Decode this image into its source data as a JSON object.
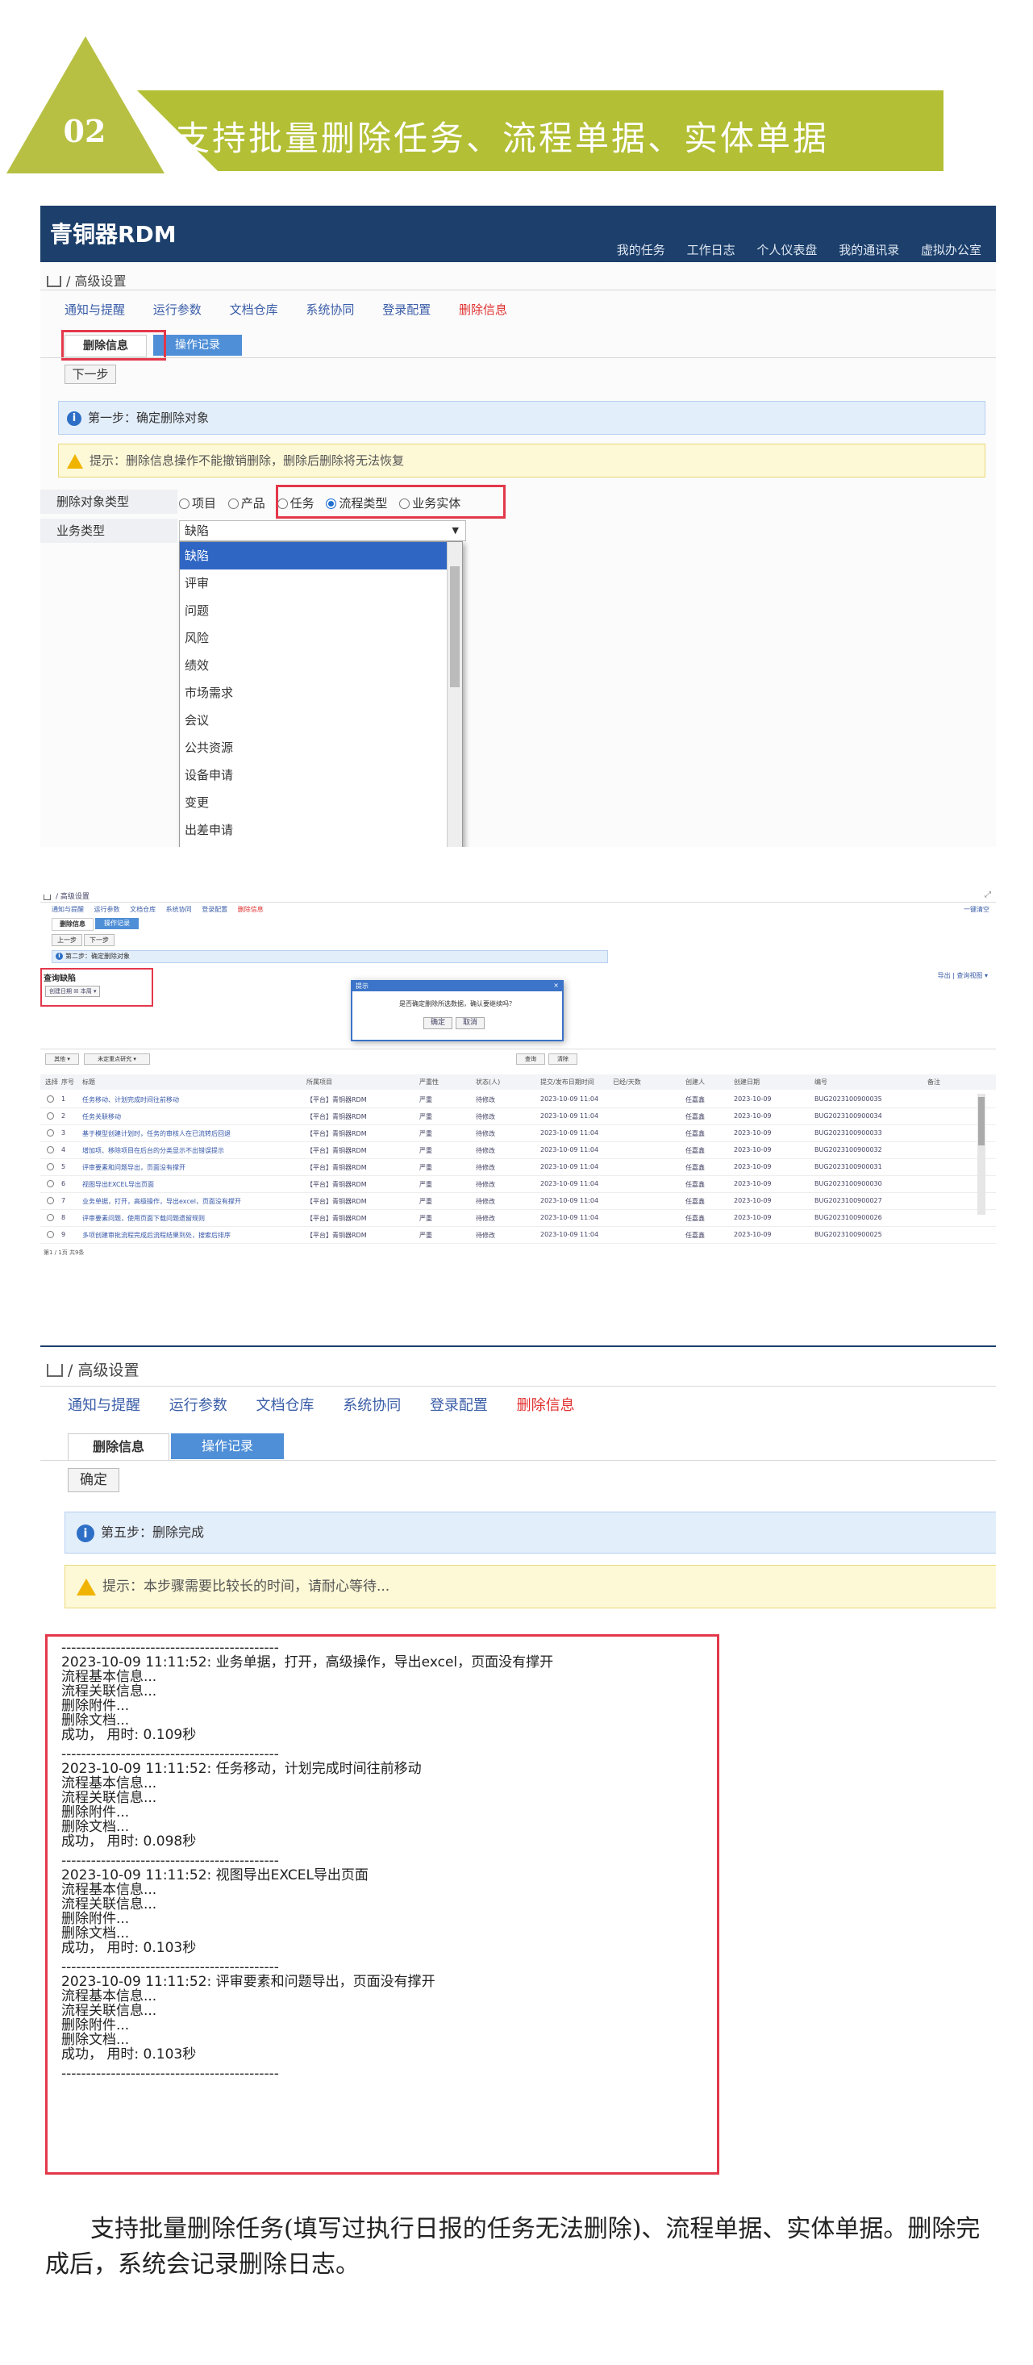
{
  "section": {
    "number": "02",
    "title": "支持批量删除任务、流程单据、实体单据"
  },
  "shot1": {
    "app_name": "青铜器RDM",
    "top_nav": [
      "我的任务",
      "工作日志",
      "个人仪表盘",
      "我的通讯录",
      "虚拟办公室"
    ],
    "breadcrumb": "高级设置",
    "tabs": [
      "通知与提醒",
      "运行参数",
      "文档仓库",
      "系统协同",
      "登录配置",
      "删除信息"
    ],
    "subtabs": [
      "删除信息",
      "操作记录"
    ],
    "next_button": "下一步",
    "step_info": "第一步：确定删除对象",
    "warning": "提示：删除信息操作不能撤销删除，删除后删除将无法恢复",
    "form": {
      "type_label": "删除对象类型",
      "type_options": [
        "项目",
        "产品",
        "任务",
        "流程类型",
        "业务实体"
      ],
      "type_selected": "流程类型",
      "biz_label": "业务类型",
      "biz_value": "缺陷"
    },
    "dropdown_items": [
      "缺陷",
      "评审",
      "问题",
      "风险",
      "绩效",
      "市场需求",
      "会议",
      "公共资源",
      "设备申请",
      "变更",
      "出差申请"
    ]
  },
  "shot2": {
    "breadcrumb": "高级设置",
    "tabs": [
      "通知与提醒",
      "运行参数",
      "文档仓库",
      "系统协同",
      "登录配置",
      "删除信息"
    ],
    "right_link": "一键清空",
    "subtabs": [
      "删除信息",
      "操作记录"
    ],
    "buttons": [
      "上一步",
      "下一步"
    ],
    "step_info": "第二步：确定删除对象",
    "query_title": "查询缺陷",
    "filter_chip": "创建日期 ☒ 本周 ▾",
    "right_tools": "导出 | 查询视图 ▾",
    "batch_label": "其他 ▾",
    "view_label": "未定重点研究 ▾",
    "search_buttons": [
      "查询",
      "清除"
    ],
    "modal": {
      "title": "提示",
      "message": "是否确定删除所选数据，确认要继续吗？",
      "ok": "确定",
      "cancel": "取消"
    },
    "columns": [
      "选择",
      "序号",
      "标题",
      "所属项目",
      "严重性",
      "状态(人)",
      "提交/发布日期时间",
      "已经/天数",
      "创建人",
      "创建日期",
      "编号",
      "备注"
    ],
    "rows": [
      [
        "1",
        "任务移动、计划完成时间往前移动",
        "【平台】青铜器RDM",
        "严重",
        "待修改",
        "2023-10-09 11:04",
        "任嘉鑫",
        "2023-10-09",
        "BUG2023100900035"
      ],
      [
        "2",
        "任务关联移动",
        "【平台】青铜器RDM",
        "严重",
        "待修改",
        "2023-10-09 11:04",
        "任嘉鑫",
        "2023-10-09",
        "BUG2023100900034"
      ],
      [
        "3",
        "基于模型创建计划时，任务的审核人在已流转后回退",
        "【平台】青铜器RDM",
        "严重",
        "待修改",
        "2023-10-09 11:04",
        "任嘉鑫",
        "2023-10-09",
        "BUG2023100900033"
      ],
      [
        "4",
        "增加项、移除项目在后台的分类显示不出错误提示",
        "【平台】青铜器RDM",
        "严重",
        "待修改",
        "2023-10-09 11:04",
        "任嘉鑫",
        "2023-10-09",
        "BUG2023100900032"
      ],
      [
        "5",
        "评审要素和问题导出，页面没有撑开",
        "【平台】青铜器RDM",
        "严重",
        "待修改",
        "2023-10-09 11:04",
        "任嘉鑫",
        "2023-10-09",
        "BUG2023100900031"
      ],
      [
        "6",
        "视图导出EXCEL导出页面",
        "【平台】青铜器RDM",
        "严重",
        "待修改",
        "2023-10-09 11:04",
        "任嘉鑫",
        "2023-10-09",
        "BUG2023100900030"
      ],
      [
        "7",
        "业务单据，打开，高级操作，导出excel，页面没有撑开",
        "【平台】青铜器RDM",
        "严重",
        "待修改",
        "2023-10-09 11:04",
        "任嘉鑫",
        "2023-10-09",
        "BUG2023100900027"
      ],
      [
        "8",
        "评审要素问题，使用页面下载问题遗留规则",
        "【平台】青铜器RDM",
        "严重",
        "待修改",
        "2023-10-09 11:04",
        "任嘉鑫",
        "2023-10-09",
        "BUG2023100900026"
      ],
      [
        "9",
        "多项创建审批流程完成后流程结果到处，搜索后排序",
        "【平台】青铜器RDM",
        "严重",
        "待修改",
        "2023-10-09 11:04",
        "任嘉鑫",
        "2023-10-09",
        "BUG2023100900025"
      ]
    ],
    "footer": "第1 / 1页  共9条"
  },
  "shot3": {
    "breadcrumb": "高级设置",
    "tabs": [
      "通知与提醒",
      "运行参数",
      "文档仓库",
      "系统协同",
      "登录配置",
      "删除信息"
    ],
    "subtabs": [
      "删除信息",
      "操作记录"
    ],
    "confirm_button": "确定",
    "step_info": "第五步：删除完成",
    "warning": "提示：本步骤需要比较长的时间，请耐心等待...",
    "separator": "--------------------------------------------",
    "log_entries": [
      {
        "head": "2023-10-09 11:11:52: 业务单据，打开，高级操作，导出excel，页面没有撑开",
        "lines": [
          "流程基本信息...",
          "流程关联信息...",
          "删除附件...",
          "删除文档...",
          "成功，  用时: 0.109秒"
        ]
      },
      {
        "head": "2023-10-09 11:11:52: 任务移动，计划完成时间往前移动",
        "lines": [
          "流程基本信息...",
          "流程关联信息...",
          "删除附件...",
          "删除文档...",
          "成功，  用时: 0.098秒"
        ]
      },
      {
        "head": "2023-10-09 11:11:52: 视图导出EXCEL导出页面",
        "lines": [
          "流程基本信息...",
          "流程关联信息...",
          "删除附件...",
          "删除文档...",
          "成功，  用时: 0.103秒"
        ]
      },
      {
        "head": "2023-10-09 11:11:52: 评审要素和问题导出，页面没有撑开",
        "lines": [
          "流程基本信息...",
          "流程关联信息...",
          "删除附件...",
          "删除文档...",
          "成功，  用时: 0.103秒"
        ]
      }
    ]
  },
  "caption": "支持批量删除任务(填写过执行日报的任务无法删除)、流程单据、实体单据。删除完成后，系统会记录删除日志。",
  "colors": {
    "accent_green": "#b3bf34",
    "navy": "#1c3f6b",
    "highlight_red": "#e3384a",
    "tab_blue": "#4f8fd7"
  }
}
